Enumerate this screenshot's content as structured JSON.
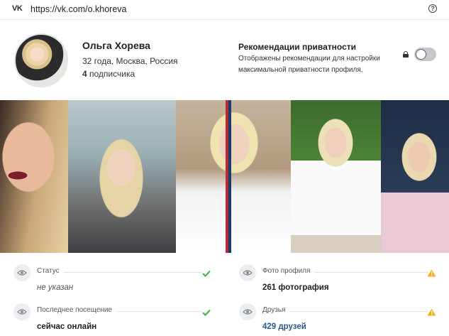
{
  "topbar": {
    "logo": "VK",
    "url": "https://vk.com/o.khoreva",
    "help_symbol": "?"
  },
  "profile": {
    "name": "Ольга Хорева",
    "meta": "32 года, Москва, Россия",
    "subscribers_count": "4",
    "subscribers_label": " подписчика"
  },
  "privacy": {
    "title": "Рекомендации приватности",
    "description": "Отображены рекомендации для настройки максимальной приватности профиля.",
    "toggle_on": false
  },
  "photos": [
    "photo-1",
    "photo-2",
    "photo-3",
    "photo-4",
    "photo-5"
  ],
  "stats": {
    "status": {
      "label": "Статус",
      "value": "не указан",
      "state": "ok"
    },
    "photo": {
      "label": "Фото профиля",
      "value": "261 фотография",
      "state": "warning"
    },
    "last_seen": {
      "label": "Последнее посещение",
      "value": "сейчас онлайн",
      "state": "ok"
    },
    "friends": {
      "label": "Друзья",
      "value": "429 друзей",
      "state": "warning"
    }
  },
  "colors": {
    "ok": "#4bb34b",
    "warning": "#f2b01e",
    "link": "#2a5885",
    "toggle_off": "#c4c8cd"
  },
  "icons": [
    "vk-logo",
    "help-icon",
    "lock-icon",
    "eye-icon",
    "check-icon",
    "warning-icon"
  ]
}
